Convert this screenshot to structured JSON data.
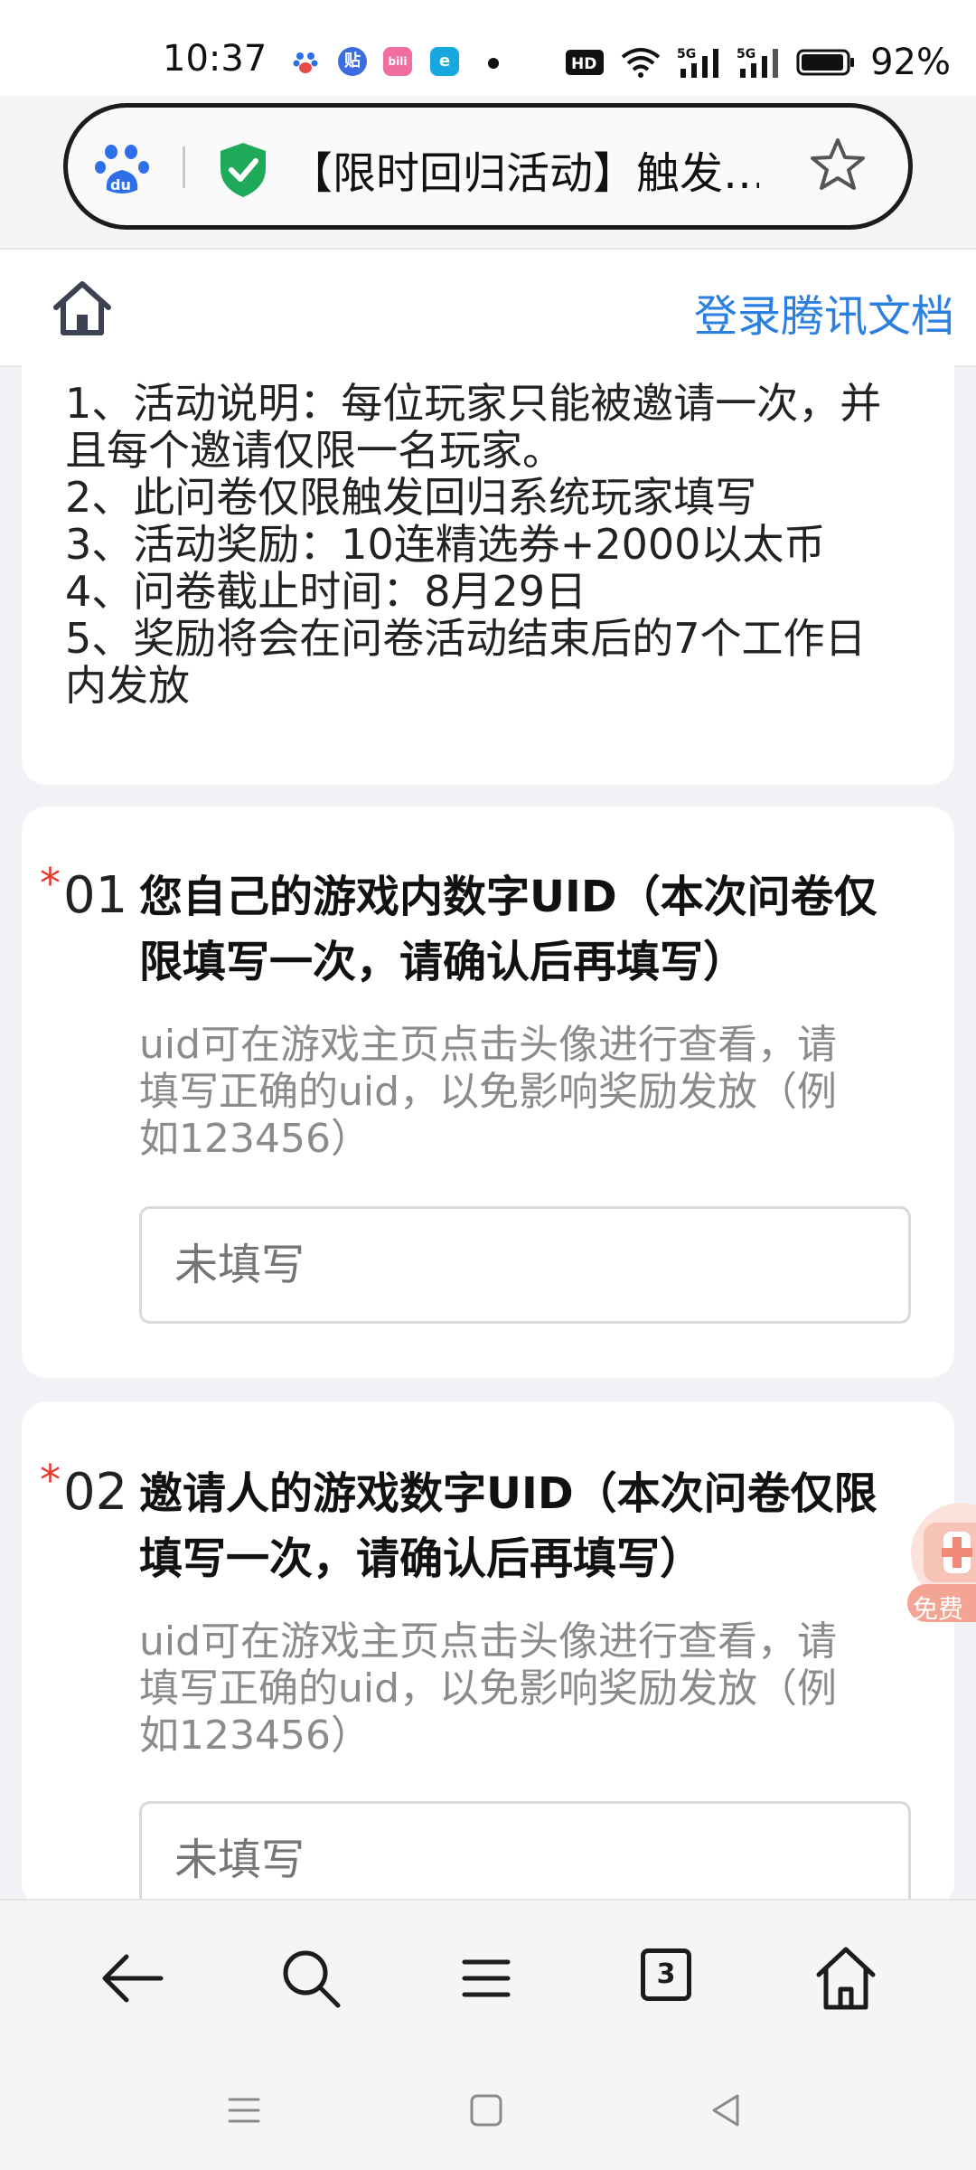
{
  "status_bar": {
    "time": "10:37",
    "app_icons": [
      "baidu-icon",
      "tieba-icon",
      "bilibili-icon",
      "edge-icon"
    ],
    "network_badge": "HD",
    "signal_labels": [
      "5G",
      "5G"
    ],
    "battery": "92%"
  },
  "address_bar": {
    "page_title": "【限时回归活动】触发…",
    "logo": "baidu-du-icon",
    "security": "shield-check-icon",
    "bookmark": "star-icon"
  },
  "doc_header": {
    "home": "home-icon",
    "login_label": "登录腾讯文档"
  },
  "info": {
    "lines": [
      "1、活动说明：每位玩家只能被邀请一次，并",
      "且每个邀请仅限一名玩家。",
      "2、此问卷仅限触发回归系统玩家填写",
      "3、活动奖励：10连精选券+2000以太币",
      "4、问卷截止时间：8月29日",
      "5、奖励将会在问卷活动结束后的7个工作日",
      "内发放"
    ]
  },
  "questions": [
    {
      "required_mark": "*",
      "number": "01",
      "title_lines": [
        "您自己的游戏内数字UID（本次问卷仅",
        "限填写一次，请确认后再填写）"
      ],
      "hint_lines": [
        "uid可在游戏主页点击头像进行查看，请",
        "填写正确的uid，以免影响奖励发放（例",
        "如123456）"
      ],
      "placeholder": "未填写"
    },
    {
      "required_mark": "*",
      "number": "02",
      "title_lines": [
        "邀请人的游戏数字UID（本次问卷仅限",
        "填写一次，请确认后再填写）"
      ],
      "hint_lines": [
        "uid可在游戏主页点击头像进行查看，请",
        "填写正确的uid，以免影响奖励发放（例",
        "如123456）"
      ],
      "placeholder": "未填写"
    }
  ],
  "float_badge": {
    "label": "免费"
  },
  "bottom_toolbar": {
    "tab_count": "3",
    "icons": [
      "back-arrow-icon",
      "search-icon",
      "menu-icon",
      "tabs-icon",
      "home-icon"
    ]
  },
  "system_nav": {
    "icons": [
      "recent-apps-icon",
      "home-square-icon",
      "back-triangle-icon"
    ]
  },
  "colors": {
    "accent_blue": "#2a7fe0",
    "required_red": "#e23a2e",
    "shield_green": "#1faa59",
    "baidu_blue": "#2e6ee8"
  }
}
